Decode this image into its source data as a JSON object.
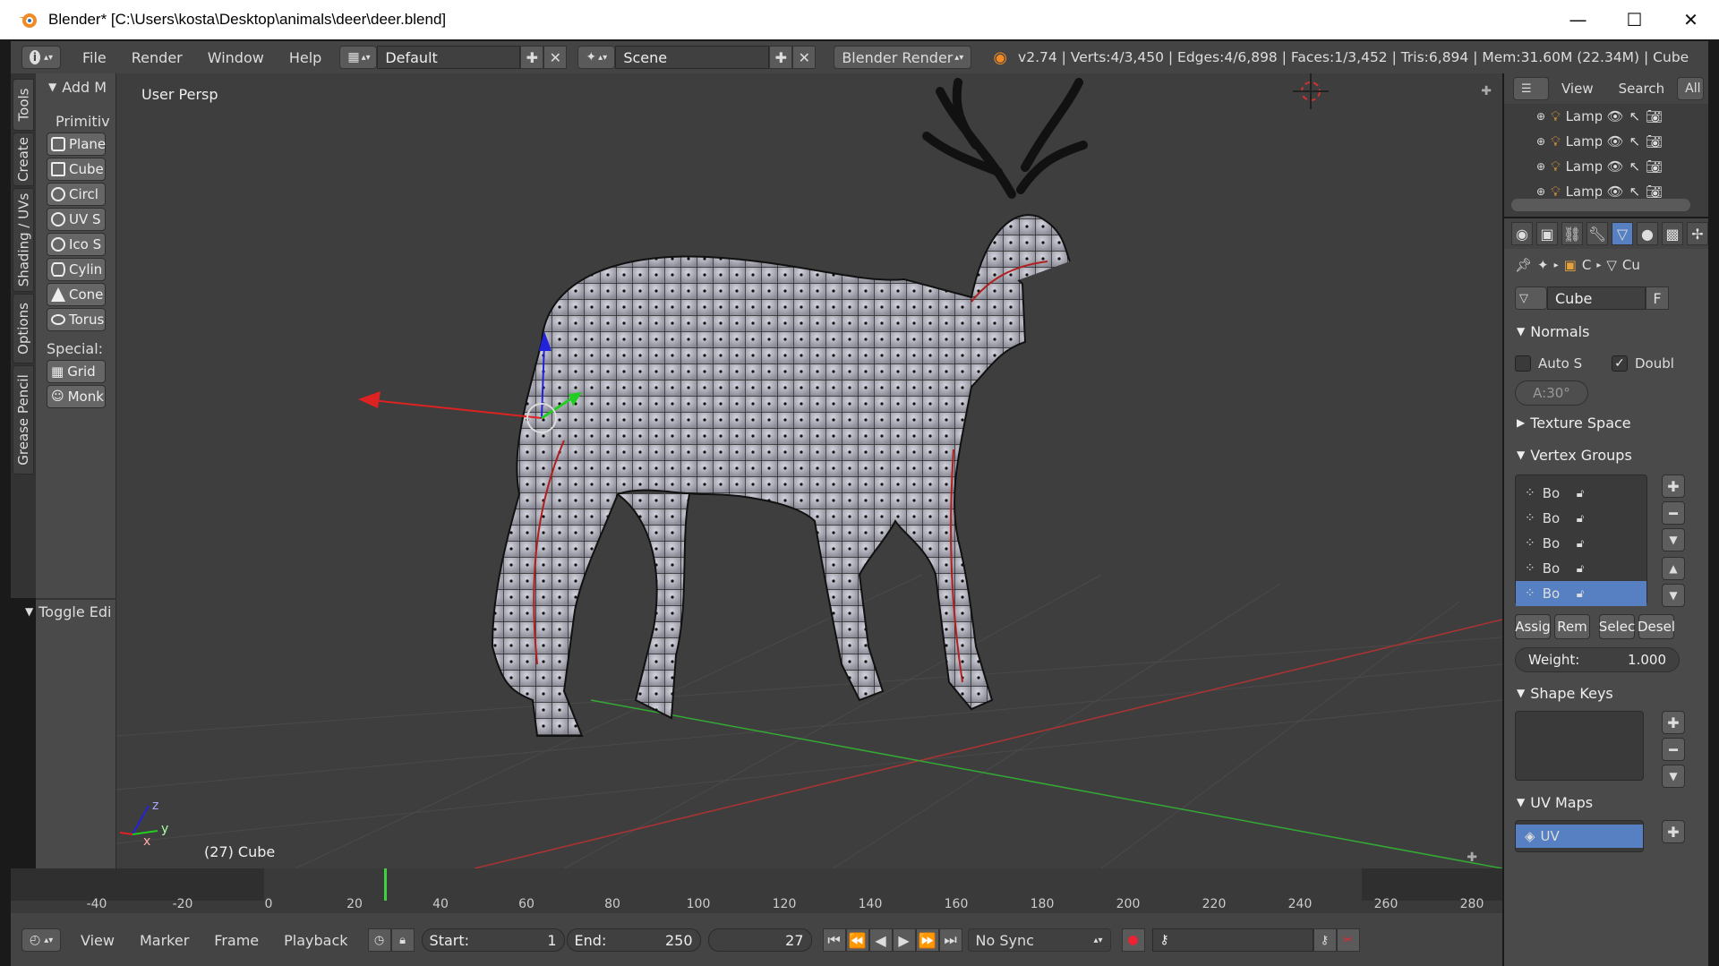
{
  "window": {
    "title": "Blender* [C:\\Users\\kosta\\Desktop\\animals\\deer\\deer.blend]",
    "minimize": "—",
    "maximize": "☐",
    "close": "✕"
  },
  "infobar": {
    "menus": [
      "File",
      "Render",
      "Window",
      "Help"
    ],
    "layout": "Default",
    "scene": "Scene",
    "engine": "Blender Render",
    "stats": "v2.74 | Verts:4/3,450 | Edges:4/6,898 | Faces:1/3,452 | Tris:6,894 | Mem:31.60M (22.34M) | Cube"
  },
  "tabs": [
    "Tools",
    "Create",
    "Shading / UVs",
    "Options",
    "Grease Pencil"
  ],
  "toolshelf": {
    "header": "Add M",
    "primitives_label": "Primitiv",
    "primitives": [
      "Plane",
      "Cube",
      "Circl",
      "UV S",
      "Ico S",
      "Cylin",
      "Cone",
      "Torus"
    ],
    "special_label": "Special:",
    "special": [
      "Grid",
      "Monk"
    ],
    "toggle": "Toggle Edi"
  },
  "viewport": {
    "view_label": "User Persp",
    "object_label": "(27) Cube",
    "axis_x": "x",
    "axis_y": "y",
    "axis_z": "z"
  },
  "timeline": {
    "ticks": [
      "-40",
      "-20",
      "0",
      "20",
      "40",
      "60",
      "80",
      "100",
      "120",
      "140",
      "160",
      "180",
      "200",
      "220",
      "240",
      "260",
      "280"
    ],
    "current_frame": 27,
    "menus": [
      "View",
      "Marker",
      "Frame",
      "Playback"
    ],
    "start_label": "Start:",
    "start": "1",
    "end_label": "End:",
    "end": "250",
    "frame": "27",
    "sync": "No Sync"
  },
  "outliner": {
    "menus": [
      "View",
      "Search",
      "All"
    ],
    "items": [
      "Lamp",
      "Lamp",
      "Lamp",
      "Lamp"
    ]
  },
  "properties": {
    "breadcrumb_obj": "C",
    "breadcrumb_data": "Cu",
    "mesh_name": "Cube",
    "fake_user": "F",
    "normals": {
      "title": "Normals",
      "auto_smooth": "Auto S",
      "double_sided": "Doubl",
      "angle": "A:30°"
    },
    "texture_space": "Texture Space",
    "vertex_groups": {
      "title": "Vertex Groups",
      "items": [
        "Bo",
        "Bo",
        "Bo",
        "Bo",
        "Bo"
      ],
      "assign": "Assig",
      "remove": "Rem",
      "select": "Selec",
      "deselect": "Desel",
      "weight_label": "Weight:",
      "weight": "1.000"
    },
    "shape_keys": "Shape Keys",
    "uv_maps": {
      "title": "UV Maps",
      "item": "UV"
    }
  },
  "colors": {
    "selection": "#5680c2",
    "viewport_bg": "#3e3e3e",
    "timeline_marker": "#3fd13f"
  }
}
